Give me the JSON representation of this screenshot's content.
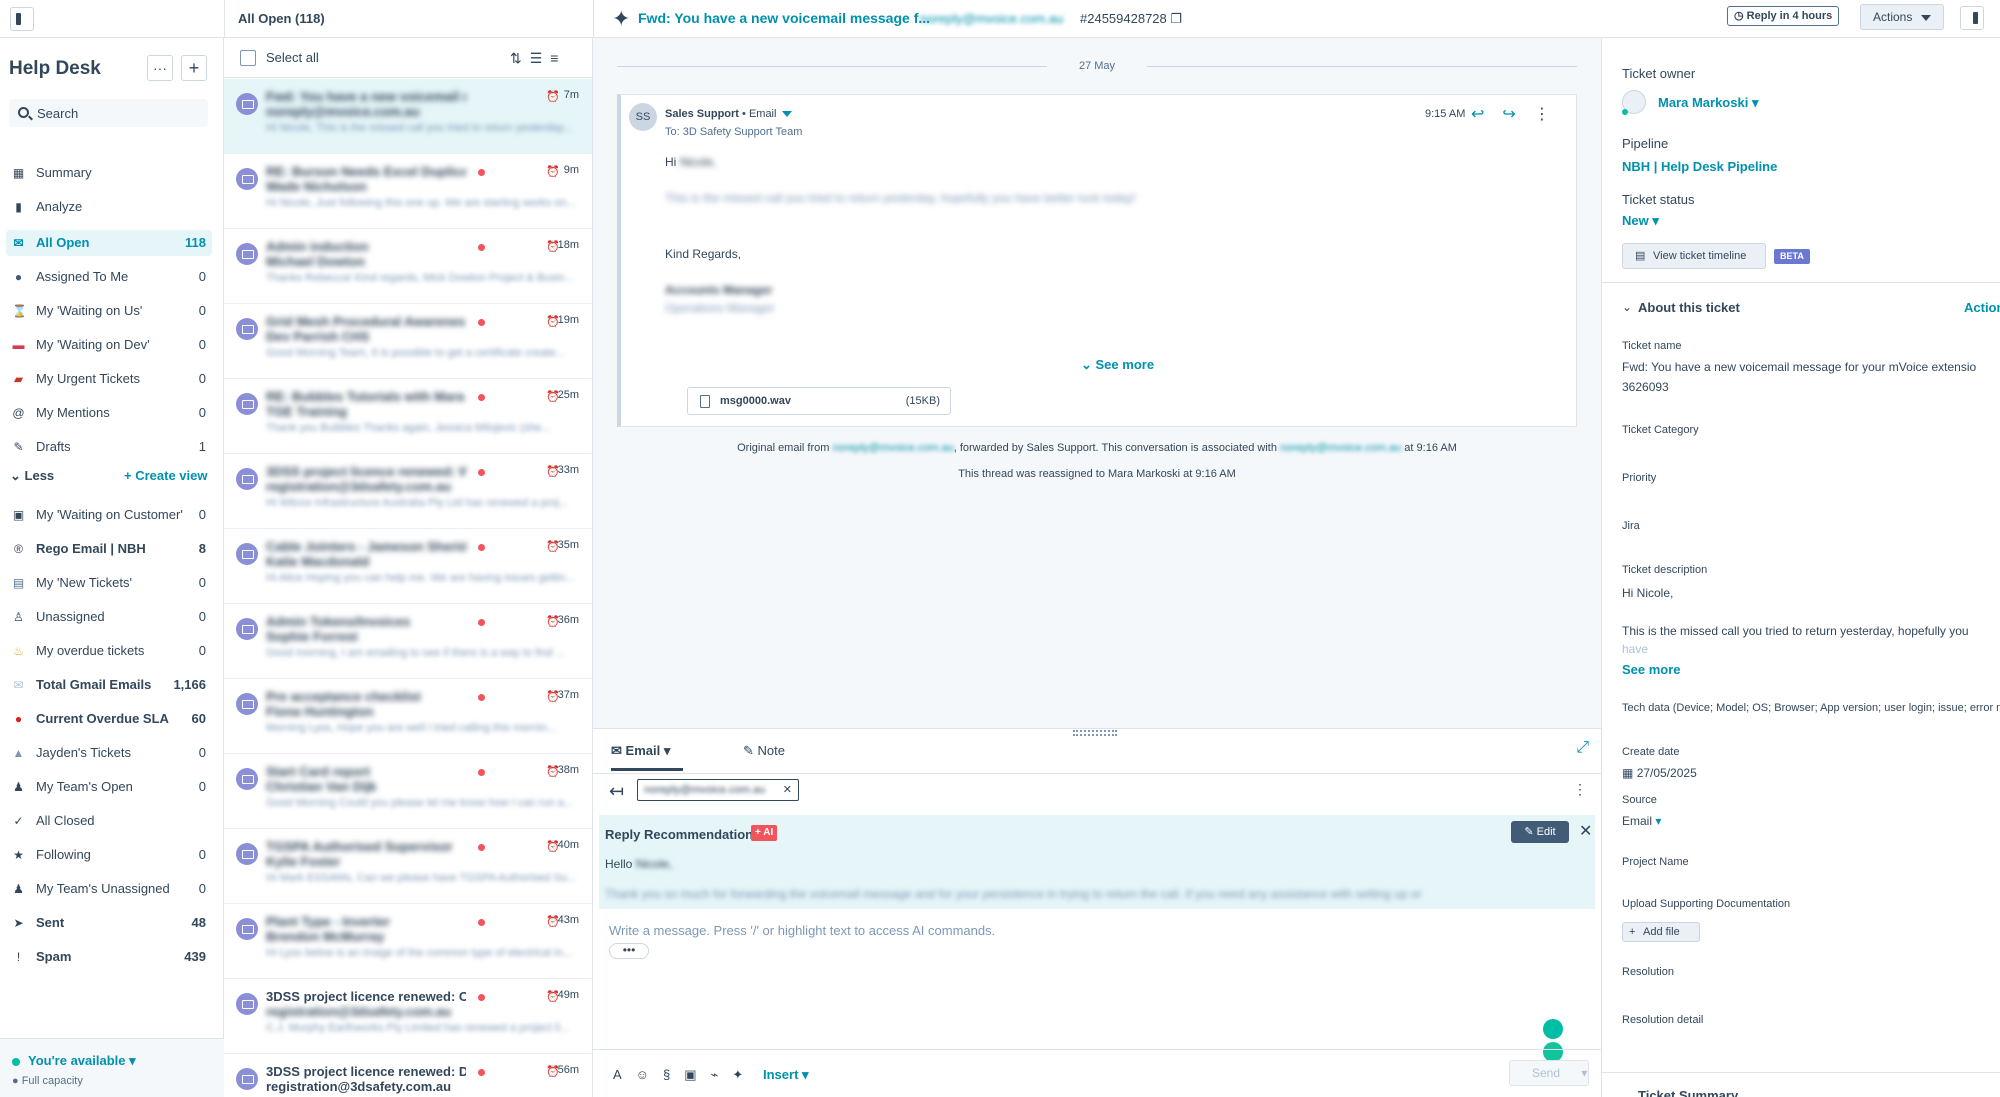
{
  "header": {
    "list_title": "All Open (118)",
    "subject": "Fwd: You have a new voicemail message f...",
    "email": "noreply@mvoice.com.au",
    "ticket_id": "#24559428728",
    "reply_badge": "Reply in 4 hours",
    "actions_label": "Actions"
  },
  "sidebar": {
    "title": "Help Desk",
    "more_label": "···",
    "add_label": "+",
    "search_placeholder": "Search",
    "less_label": "Less",
    "create_view_label": "Create view",
    "items": [
      {
        "label": "Summary",
        "count": "",
        "icon": "▦"
      },
      {
        "label": "Analyze",
        "count": "",
        "icon": "▮"
      },
      {
        "label": "All Open",
        "count": "118",
        "icon": "✉"
      },
      {
        "label": "Assigned To Me",
        "count": "0",
        "icon": "●"
      },
      {
        "label": "My 'Waiting on Us'",
        "count": "0",
        "icon": "⌛"
      },
      {
        "label": "My 'Waiting on Dev'",
        "count": "0",
        "icon": "▬"
      },
      {
        "label": "My Urgent Tickets",
        "count": "0",
        "icon": "▰"
      },
      {
        "label": "My Mentions",
        "count": "0",
        "icon": "@"
      },
      {
        "label": "Drafts",
        "count": "1",
        "icon": "✎"
      },
      {
        "label": "My 'Waiting on Customer'",
        "count": "0",
        "icon": "▣"
      },
      {
        "label": "Rego Email | NBH",
        "count": "8",
        "icon": "®"
      },
      {
        "label": "My 'New Tickets'",
        "count": "0",
        "icon": "▤"
      },
      {
        "label": "Unassigned",
        "count": "0",
        "icon": "♙"
      },
      {
        "label": "My overdue tickets",
        "count": "0",
        "icon": "♨"
      },
      {
        "label": "Total Gmail Emails",
        "count": "1,166",
        "icon": "✉"
      },
      {
        "label": "Current Overdue SLA",
        "count": "60",
        "icon": "●"
      },
      {
        "label": "Jayden's Tickets",
        "count": "0",
        "icon": "▲"
      },
      {
        "label": "My Team's Open",
        "count": "0",
        "icon": "♟"
      },
      {
        "label": "All Closed",
        "count": "",
        "icon": "✓"
      },
      {
        "label": "Following",
        "count": "0",
        "icon": "★"
      },
      {
        "label": "My Team's Unassigned",
        "count": "0",
        "icon": "♟"
      },
      {
        "label": "Sent",
        "count": "48",
        "icon": "➤"
      },
      {
        "label": "Spam",
        "count": "439",
        "icon": "!"
      }
    ],
    "availability": "You're available",
    "capacity": "Full capacity"
  },
  "list": {
    "select_all": "Select all",
    "rows": [
      {
        "l1": "Fwd: You have a new voicemail me...",
        "l2": "noreply@mvoice.com.au",
        "l3": "Hi Nicole, This is the missed call you tried to return yesterday...",
        "age": "7m",
        "dot": false
      },
      {
        "l1": "RE: Burson Needs Excel Duplica...",
        "l2": "Wade Nicholson",
        "l3": "Hi Nicole, Just following this one up. We are starting works on...",
        "age": "9m",
        "dot": true
      },
      {
        "l1": "Admin induction",
        "l2": "Michael Dowton",
        "l3": "Thanks Rebecca! Kind regards, Mick Dowton Project & Busin...",
        "age": "18m",
        "dot": true
      },
      {
        "l1": "Grid Mesh Procedural Awarenes...",
        "l2": "Dev Parrish CHS",
        "l3": "Good Morning Team, It is possible to get a certificate create...",
        "age": "19m",
        "dot": true
      },
      {
        "l1": "RE: Bubbles Tutorials with Mara",
        "l2": "TGE Training",
        "l3": "Thank you Bubbles Thanks again, Jessica Milojevic (she...",
        "age": "25m",
        "dot": true
      },
      {
        "l1": "3DSS project licence renewed: W...",
        "l2": "registration@3dsafety.com.au",
        "l3": "Hi Wilcox Infrastructure Australia Pty Ltd has renewed a proj...",
        "age": "33m",
        "dot": true
      },
      {
        "l1": "Cable Jointers - Jameson Sherid...",
        "l2": "Katie Macdonald",
        "l3": "Hi Alice Hoping you can help me. We are having issues gettin...",
        "age": "35m",
        "dot": true
      },
      {
        "l1": "Admin Tokens/Invoices",
        "l2": "Sophie Forrest",
        "l3": "Good morning, I am emailing to see if there is a way to find ...",
        "age": "36m",
        "dot": true
      },
      {
        "l1": "Pre acceptance checklist",
        "l2": "Fiona Huntington",
        "l3": "Morning Lyss, Hope you are well I tried calling this mornin...",
        "age": "37m",
        "dot": true
      },
      {
        "l1": "Start Card report",
        "l2": "Christian Van Dijk",
        "l3": "Good Morning Could you please let me know how I can run a...",
        "age": "38m",
        "dot": true
      },
      {
        "l1": "TGSPA Authorised Supervisor",
        "l2": "Kylie Foster",
        "l3": "Hi Mark ESSAMs, Can we please have TGSPA Authorised Su...",
        "age": "40m",
        "dot": true
      },
      {
        "l1": "Plant Type - Inverter",
        "l2": "Brendon McMurray",
        "l3": "Hi Lyss below is an image of the common type of electrical in...",
        "age": "43m",
        "dot": true
      },
      {
        "l1": "3DSS project licence renewed: C...",
        "l2": "registration@3dsafety.com.au",
        "l3": "C.J. Murphy Earthworks Pty Limited has renewed a project li...",
        "age": "49m",
        "dot": true,
        "clear1": true
      },
      {
        "l1": "3DSS project licence renewed: Di...",
        "l2": "registration@3dsafety.com.au",
        "l3": "",
        "age": "56m",
        "dot": true,
        "clear1": true,
        "clear2": true
      }
    ]
  },
  "conversation": {
    "date": "27 May",
    "avatar": "SS",
    "sender": "Sales Support",
    "channel": "• Email",
    "to": "To: 3D Safety Support Team",
    "time": "9:15 AM",
    "greeting": "Hi",
    "greeting_name": "Nicole,",
    "body_line": "This is the missed call you tried to return yesterday, hopefully you have better luck today!",
    "regards": "Kind Regards,",
    "sig_name": "Accounts Manager",
    "sig_title": "Operations Manager",
    "see_more": "See more",
    "attachment_name": "msg0000.wav",
    "attachment_size": "(15KB)",
    "orig_prefix": "Original email from",
    "orig_from": "noreply@mvoice.com.au",
    "orig_mid": ", forwarded by Sales Support. This conversation is associated with",
    "orig_assoc": "noreply@mvoice.com.au",
    "orig_suffix": "at 9:16 AM",
    "reassigned": "This thread was reassigned to Mara Markoski at 9:16 AM"
  },
  "composer": {
    "tab_email": "Email",
    "tab_note": "Note",
    "recipient": "noreply@mvoice.com.au",
    "rec_title": "Reply Recommendation",
    "ai_badge": "+ AI",
    "edit_label": "Edit",
    "hello": "Hello",
    "hello_name": "Nicole,",
    "thanks_line": "Thank you so much for forwarding the voicemail message and for your persistence in trying to return the call. If you need any assistance with setting up or",
    "placeholder": "Write a message. Press '/' or highlight text to access AI commands.",
    "insert_label": "Insert",
    "send_label": "Send"
  },
  "right_panel": {
    "owner_label": "Ticket owner",
    "owner_name": "Mara Markoski",
    "pipeline_label": "Pipeline",
    "pipeline_value": "NBH | Help Desk Pipeline",
    "status_label": "Ticket status",
    "status_value": "New",
    "timeline_label": "View ticket timeline",
    "beta": "BETA",
    "about_label": "About this ticket",
    "actions_label": "Actions",
    "ticket_name_label": "Ticket name",
    "ticket_name_l1": "Fwd: You have a new voicemail message for your mVoice extensio",
    "ticket_name_l2": "3626093",
    "category_label": "Ticket Category",
    "priority_label": "Priority",
    "jira_label": "Jira",
    "desc_label": "Ticket description",
    "desc_l1": "Hi Nicole,",
    "desc_l2": "This is the missed call you tried to return yesterday, hopefully you",
    "desc_l3": "have",
    "see_more": "See more",
    "tech_label": "Tech data (Device; Model; OS; Browser; App version; user login; issue; error m",
    "create_label": "Create date",
    "create_value": "27/05/2025",
    "source_label": "Source",
    "source_value": "Email",
    "project_label": "Project Name",
    "upload_label": "Upload Supporting Documentation",
    "add_file": "Add file",
    "resolution_label": "Resolution",
    "resolution_detail_label": "Resolution detail",
    "summary_label": "Ticket Summary"
  },
  "colors": {
    "accent": "#0091ae",
    "text": "#33475b",
    "active_bg": "#e5f5f8",
    "avatar": "#8b8fd6",
    "unread": "#f2545b"
  }
}
